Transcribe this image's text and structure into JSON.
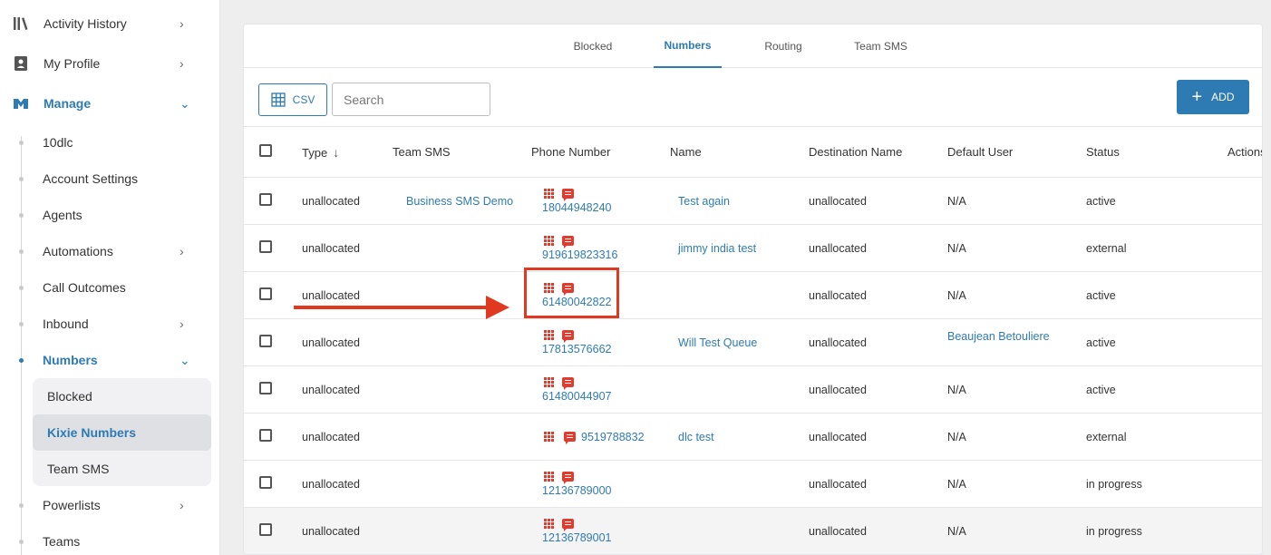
{
  "sidebar": {
    "top_items": [
      {
        "label": "Activity History",
        "icon": "library-icon"
      },
      {
        "label": "My Profile",
        "icon": "contact-card-icon"
      },
      {
        "label": "Manage",
        "icon": "manage-icon"
      }
    ],
    "manage_items": [
      {
        "label": "10dlc"
      },
      {
        "label": "Account Settings"
      },
      {
        "label": "Agents"
      },
      {
        "label": "Automations"
      },
      {
        "label": "Call Outcomes"
      },
      {
        "label": "Inbound"
      },
      {
        "label": "Numbers"
      },
      {
        "label": "Powerlists"
      },
      {
        "label": "Teams"
      }
    ],
    "numbers_sub_items": [
      {
        "label": "Blocked"
      },
      {
        "label": "Kixie Numbers"
      },
      {
        "label": "Team SMS"
      }
    ]
  },
  "tabs": [
    {
      "label": "Blocked"
    },
    {
      "label": "Numbers"
    },
    {
      "label": "Routing"
    },
    {
      "label": "Team SMS"
    }
  ],
  "toolbar": {
    "csv_label": "CSV",
    "search_placeholder": "Search",
    "add_label": "ADD"
  },
  "table": {
    "headers": {
      "type": "Type",
      "team_sms": "Team SMS",
      "phone_number": "Phone Number",
      "name": "Name",
      "destination_name": "Destination Name",
      "default_user": "Default User",
      "status": "Status",
      "actions": "Actions"
    },
    "rows": [
      {
        "type": "unallocated",
        "team_sms": "Business SMS Demo",
        "phone": "18044948240",
        "name": "Test again",
        "destination": "unallocated",
        "default_user": "N/A",
        "status": "active"
      },
      {
        "type": "unallocated",
        "team_sms": "",
        "phone": "919619823316",
        "name": "jimmy india test",
        "destination": "unallocated",
        "default_user": "N/A",
        "status": "external"
      },
      {
        "type": "unallocated",
        "team_sms": "",
        "phone": "61480042822",
        "name": "",
        "destination": "unallocated",
        "default_user": "N/A",
        "status": "active"
      },
      {
        "type": "unallocated",
        "team_sms": "",
        "phone": "17813576662",
        "name": "Will Test Queue",
        "destination": "unallocated",
        "default_user": "Beaujean Betouliere",
        "status": "active"
      },
      {
        "type": "unallocated",
        "team_sms": "",
        "phone": "61480044907",
        "name": "",
        "destination": "unallocated",
        "default_user": "N/A",
        "status": "active"
      },
      {
        "type": "unallocated",
        "team_sms": "",
        "phone": "9519788832",
        "name": "dlc test",
        "destination": "unallocated",
        "default_user": "N/A",
        "status": "external"
      },
      {
        "type": "unallocated",
        "team_sms": "",
        "phone": "12136789000",
        "name": "",
        "destination": "unallocated",
        "default_user": "N/A",
        "status": "in progress"
      },
      {
        "type": "unallocated",
        "team_sms": "",
        "phone": "12136789001",
        "name": "",
        "destination": "unallocated",
        "default_user": "N/A",
        "status": "in progress"
      }
    ]
  },
  "colors": {
    "accent": "#2e7bb4",
    "annotation": "#e0391f",
    "phone_icons": "#e23b2e"
  }
}
